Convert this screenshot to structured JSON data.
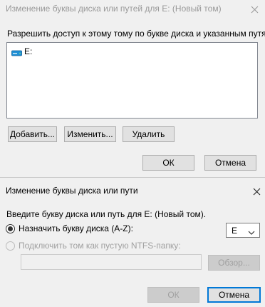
{
  "top_dialog": {
    "title": "Изменение буквы диска или путей для E: (Новый том)",
    "description": "Разрешить доступ к этому тому по букве диска и указанным путям.",
    "list_items": [
      {
        "label": "E:",
        "icon": "drive-icon"
      }
    ],
    "add_button": "Добавить...",
    "change_button": "Изменить...",
    "remove_button": "Удалить",
    "ok_button": "ОК",
    "cancel_button": "Отмена"
  },
  "bottom_dialog": {
    "title": "Изменение буквы диска или пути",
    "description": "Введите букву диска или путь для E: (Новый том).",
    "assign_letter_label": "Назначить букву диска (A-Z):",
    "assign_letter_selected": true,
    "drive_letter_value": "E",
    "mount_folder_label": "Подключить том как пустую NTFS-папку:",
    "mount_folder_selected": false,
    "folder_path_value": "",
    "browse_button": "Обзор...",
    "ok_button": "ОК",
    "cancel_button": "Отмена"
  },
  "colors": {
    "window_bg": "#f0f0f0",
    "accent": "#0078d7",
    "disabled_text": "#a0a0a0",
    "drive_icon": "#1e90d6"
  }
}
